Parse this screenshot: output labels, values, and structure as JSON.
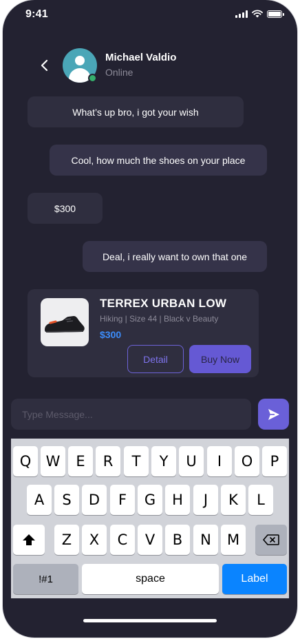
{
  "status_bar": {
    "time": "9:41"
  },
  "contact": {
    "name": "Michael Valdio",
    "status": "Online"
  },
  "messages": [
    {
      "text": "What’s up bro, i got your wish",
      "direction": "incoming"
    },
    {
      "text": "Cool, how much the shoes on your place",
      "direction": "outgoing"
    },
    {
      "text": "$300",
      "direction": "incoming"
    },
    {
      "text": "Deal, i really want to own that one",
      "direction": "outgoing"
    }
  ],
  "product": {
    "title": "TERREX URBAN LOW",
    "meta": "Hiking | Size 44 | Black v Beauty",
    "price": "$300",
    "detail_label": "Detail",
    "buy_label": "Buy Now"
  },
  "composer": {
    "placeholder": "Type Message..."
  },
  "keyboard": {
    "row1": [
      "Q",
      "W",
      "E",
      "R",
      "T",
      "Y",
      "U",
      "I",
      "O",
      "P"
    ],
    "row2": [
      "A",
      "S",
      "D",
      "F",
      "G",
      "H",
      "J",
      "K",
      "L"
    ],
    "row3": [
      "Z",
      "X",
      "C",
      "V",
      "B",
      "N",
      "M"
    ],
    "numbers_key": "!#1",
    "space_key": "space",
    "action_key": "Label"
  },
  "colors": {
    "background": "#232231",
    "bubble": "#2f2e3f",
    "accent": "#6a60d8",
    "price": "#3c8dfb",
    "online": "#35b06c",
    "keyboard_action": "#0a84ff"
  },
  "icons": {
    "back": "chevron-left-icon",
    "send": "send-icon",
    "shift": "shift-icon",
    "backspace": "backspace-icon"
  }
}
